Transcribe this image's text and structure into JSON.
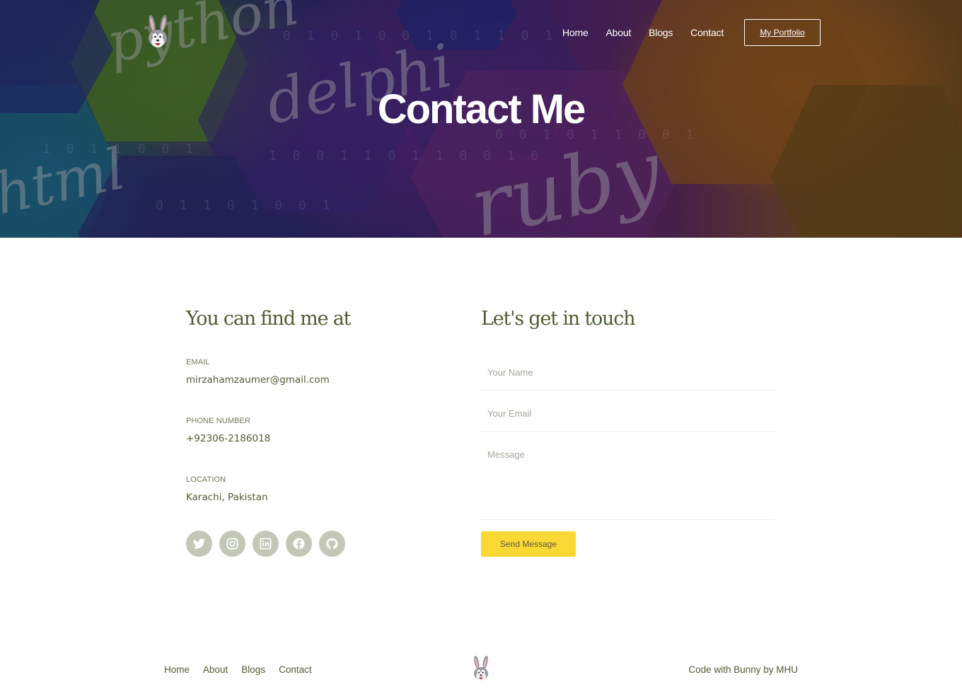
{
  "hero": {
    "background_words": [
      "python",
      "delphi",
      "html",
      "ruby"
    ],
    "title": "Contact Me"
  },
  "header": {
    "logo_icon": "bunny-mascot-icon",
    "nav": [
      {
        "label": "Home"
      },
      {
        "label": "About"
      },
      {
        "label": "Blogs"
      },
      {
        "label": "Contact"
      }
    ],
    "portfolio_label": "My Portfolio"
  },
  "contact_info": {
    "heading": "You can find me at",
    "email_label": "EMAIL",
    "email_value": "mirzahamzaumer@gmail.com",
    "phone_label": "PHONE NUMBER",
    "phone_value": "+92306-2186018",
    "location_label": "LOCATION",
    "location_value": "Karachi, Pakistan",
    "socials": [
      {
        "icon": "twitter-icon"
      },
      {
        "icon": "instagram-icon"
      },
      {
        "icon": "linkedin-icon"
      },
      {
        "icon": "facebook-icon"
      },
      {
        "icon": "github-icon"
      }
    ]
  },
  "contact_form": {
    "heading": "Let's get in touch",
    "name_placeholder": "Your Name",
    "email_placeholder": "Your Email",
    "message_placeholder": "Message",
    "submit_label": "Send Message"
  },
  "footer": {
    "nav": [
      {
        "label": "Home"
      },
      {
        "label": "About"
      },
      {
        "label": "Blogs"
      },
      {
        "label": "Contact"
      }
    ],
    "logo_icon": "bunny-mascot-icon",
    "credit": "Code with Bunny by MHU"
  },
  "colors": {
    "accent_yellow": "#fbd935",
    "text_green": "#4d5d33",
    "social_bg": "#c2c7b6"
  }
}
